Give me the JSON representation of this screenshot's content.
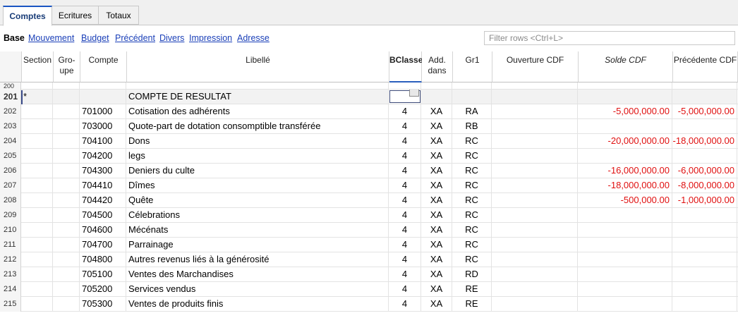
{
  "tabs": [
    "Comptes",
    "Ecritures",
    "Totaux"
  ],
  "views": [
    "Base",
    "Mouvement",
    "Budget",
    "Précédent",
    "Divers",
    "Impression",
    "Adresse"
  ],
  "filter_placeholder": "Filter rows <Ctrl+L>",
  "headers": [
    "Section",
    "Gro-\nupe",
    "Compte",
    "Libellé",
    "BClasse",
    "Add.\ndans",
    "Gr1",
    "Ouverture CDF",
    "Solde CDF",
    "Précédente CDF"
  ],
  "partial_top_row": "200",
  "rows": [
    {
      "n": "201",
      "section": "*",
      "groupe": "",
      "compte": "",
      "libelle": "COMPTE DE RESULTAT",
      "bclasse": "",
      "add": "",
      "gr1": "",
      "ouverture": "",
      "solde": "",
      "precedente": ""
    },
    {
      "n": "202",
      "section": "",
      "groupe": "",
      "compte": "701000",
      "libelle": "Cotisation des adhérents",
      "bclasse": "4",
      "add": "XA",
      "gr1": "RA",
      "ouverture": "",
      "solde": "-5,000,000.00",
      "precedente": "-5,000,000.00"
    },
    {
      "n": "203",
      "section": "",
      "groupe": "",
      "compte": "703000",
      "libelle": "Quote-part de dotation consomptible transférée",
      "bclasse": "4",
      "add": "XA",
      "gr1": "RB",
      "ouverture": "",
      "solde": "",
      "precedente": ""
    },
    {
      "n": "204",
      "section": "",
      "groupe": "",
      "compte": "704100",
      "libelle": "Dons",
      "bclasse": "4",
      "add": "XA",
      "gr1": "RC",
      "ouverture": "",
      "solde": "-20,000,000.00",
      "precedente": "-18,000,000.00"
    },
    {
      "n": "205",
      "section": "",
      "groupe": "",
      "compte": "704200",
      "libelle": "legs",
      "bclasse": "4",
      "add": "XA",
      "gr1": "RC",
      "ouverture": "",
      "solde": "",
      "precedente": ""
    },
    {
      "n": "206",
      "section": "",
      "groupe": "",
      "compte": "704300",
      "libelle": "Deniers du culte",
      "bclasse": "4",
      "add": "XA",
      "gr1": "RC",
      "ouverture": "",
      "solde": "-16,000,000.00",
      "precedente": "-6,000,000.00"
    },
    {
      "n": "207",
      "section": "",
      "groupe": "",
      "compte": "704410",
      "libelle": " Dîmes",
      "bclasse": "4",
      "add": "XA",
      "gr1": "RC",
      "ouverture": "",
      "solde": "-18,000,000.00",
      "precedente": "-8,000,000.00"
    },
    {
      "n": "208",
      "section": "",
      "groupe": "",
      "compte": "704420",
      "libelle": "Quête",
      "bclasse": "4",
      "add": "XA",
      "gr1": "RC",
      "ouverture": "",
      "solde": "-500,000.00",
      "precedente": "-1,000,000.00"
    },
    {
      "n": "209",
      "section": "",
      "groupe": "",
      "compte": "704500",
      "libelle": "Célebrations",
      "bclasse": "4",
      "add": "XA",
      "gr1": "RC",
      "ouverture": "",
      "solde": "",
      "precedente": ""
    },
    {
      "n": "210",
      "section": "",
      "groupe": "",
      "compte": "704600",
      "libelle": "Mécénats",
      "bclasse": "4",
      "add": "XA",
      "gr1": "RC",
      "ouverture": "",
      "solde": "",
      "precedente": ""
    },
    {
      "n": "211",
      "section": "",
      "groupe": "",
      "compte": "704700",
      "libelle": "Parrainage",
      "bclasse": "4",
      "add": "XA",
      "gr1": "RC",
      "ouverture": "",
      "solde": "",
      "precedente": ""
    },
    {
      "n": "212",
      "section": "",
      "groupe": "",
      "compte": "704800",
      "libelle": "Autres revenus liés à la générosité",
      "bclasse": "4",
      "add": "XA",
      "gr1": "RC",
      "ouverture": "",
      "solde": "",
      "precedente": ""
    },
    {
      "n": "213",
      "section": "",
      "groupe": "",
      "compte": "705100",
      "libelle": "Ventes des Marchandises",
      "bclasse": "4",
      "add": "XA",
      "gr1": "RD",
      "ouverture": "",
      "solde": "",
      "precedente": ""
    },
    {
      "n": "214",
      "section": "",
      "groupe": "",
      "compte": "705200",
      "libelle": "Services vendus",
      "bclasse": "4",
      "add": "XA",
      "gr1": "RE",
      "ouverture": "",
      "solde": "",
      "precedente": ""
    },
    {
      "n": "215",
      "section": "",
      "groupe": "",
      "compte": "705300",
      "libelle": "Ventes de produits finis",
      "bclasse": "4",
      "add": "XA",
      "gr1": "RE",
      "ouverture": "",
      "solde": "",
      "precedente": ""
    }
  ]
}
